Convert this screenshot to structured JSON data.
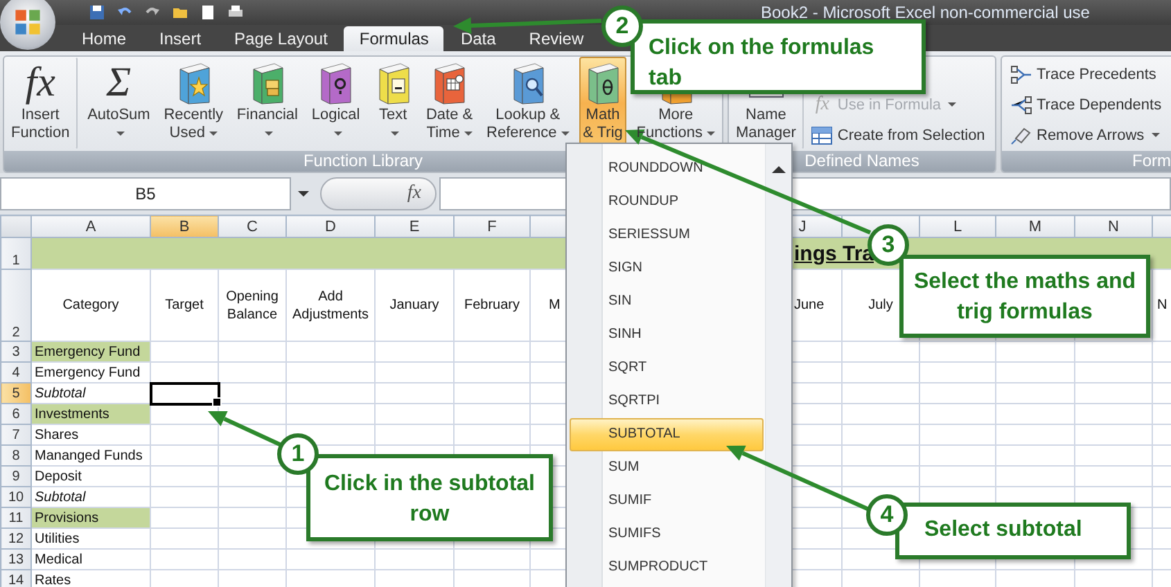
{
  "window": {
    "title": "Book2 - Microsoft Excel non-commercial use"
  },
  "tabs": [
    {
      "label": "Home",
      "selected": false
    },
    {
      "label": "Insert",
      "selected": false
    },
    {
      "label": "Page Layout",
      "selected": false
    },
    {
      "label": "Formulas",
      "selected": true
    },
    {
      "label": "Data",
      "selected": false
    },
    {
      "label": "Review",
      "selected": false
    }
  ],
  "ribbon": {
    "groups": [
      {
        "label": "Function Library",
        "items": [
          {
            "kind": "large",
            "lines": [
              "Insert",
              "Function"
            ],
            "icon": {
              "kind": "glyph",
              "glyph": "fx"
            },
            "dropdown": false,
            "pressed": false
          },
          {
            "kind": "large",
            "lines": [
              "AutoSum"
            ],
            "icon": {
              "kind": "glyph",
              "glyph": "Σ"
            },
            "dropdown": true,
            "pressed": false
          },
          {
            "kind": "large",
            "lines": [
              "Recently",
              "Used"
            ],
            "icon": {
              "kind": "star",
              "color": "#4fa3d9"
            },
            "dropdown": true,
            "pressed": false
          },
          {
            "kind": "large",
            "lines": [
              "Financial"
            ],
            "icon": {
              "kind": "coins",
              "color": "#4caf6a"
            },
            "dropdown": true,
            "pressed": false
          },
          {
            "kind": "large",
            "lines": [
              "Logical"
            ],
            "icon": {
              "kind": "question",
              "color": "#b46ac8"
            },
            "dropdown": true,
            "pressed": false
          },
          {
            "kind": "large",
            "lines": [
              "Text"
            ],
            "icon": {
              "kind": "letter",
              "color": "#eedd4a"
            },
            "dropdown": true,
            "pressed": false
          },
          {
            "kind": "large",
            "lines": [
              "Date &",
              "Time"
            ],
            "icon": {
              "kind": "calendar",
              "color": "#e8643c"
            },
            "dropdown": true,
            "pressed": false
          },
          {
            "kind": "large",
            "lines": [
              "Lookup &",
              "Reference"
            ],
            "icon": {
              "kind": "magnifier",
              "color": "#5a9ad6"
            },
            "dropdown": true,
            "pressed": false
          },
          {
            "kind": "large",
            "lines": [
              "Math",
              "& Trig"
            ],
            "icon": {
              "kind": "theta",
              "color": "#7bbf8a"
            },
            "dropdown": false,
            "pressed": true
          },
          {
            "kind": "large",
            "lines": [
              "More",
              "Functions"
            ],
            "icon": {
              "kind": "stack"
            },
            "dropdown": true,
            "pressed": false
          }
        ]
      },
      {
        "label": "Defined Names",
        "items": [
          {
            "kind": "large",
            "lines": [
              "Name",
              "Manager"
            ],
            "icon": {
              "kind": "card"
            },
            "dropdown": false,
            "pressed": false
          },
          {
            "kind": "stack",
            "buttons": [
              {
                "label": "Use in Formula",
                "icon": {
                  "kind": "glyph",
                  "glyph": "fx"
                },
                "disabled": true,
                "dropdown": true
              },
              {
                "label": "Create from Selection",
                "icon": {
                  "kind": "table"
                },
                "disabled": false,
                "dropdown": false
              }
            ]
          }
        ]
      },
      {
        "label": "Form",
        "items": [
          {
            "kind": "stack",
            "buttons": [
              {
                "label": "Trace Precedents",
                "icon": {
                  "kind": "precedents"
                },
                "disabled": false,
                "dropdown": false
              },
              {
                "label": "Trace Dependents",
                "icon": {
                  "kind": "dependents"
                },
                "disabled": false,
                "dropdown": false
              },
              {
                "label": "Remove Arrows",
                "icon": {
                  "kind": "eraser"
                },
                "disabled": false,
                "dropdown": true
              }
            ]
          }
        ]
      }
    ]
  },
  "sheet": {
    "name_box": "B5",
    "formula_glyph": "fx",
    "columns": [
      {
        "label": "A",
        "selected": false
      },
      {
        "label": "B",
        "selected": true
      },
      {
        "label": "C",
        "selected": false
      },
      {
        "label": "D",
        "selected": false
      },
      {
        "label": "E",
        "selected": false
      },
      {
        "label": "F",
        "selected": false
      },
      {},
      {},
      {},
      {
        "label": "J",
        "selected": false
      },
      {},
      {
        "label": "L",
        "selected": false
      },
      {
        "label": "M",
        "selected": false
      },
      {
        "label": "N",
        "selected": false
      },
      {}
    ],
    "rows": [
      {
        "number": "1",
        "kind": "title",
        "selected": false,
        "title": "ings Tra"
      },
      {
        "number": "2",
        "kind": "header",
        "selected": false,
        "cells": [
          "Category",
          "Target",
          "Opening Balance",
          "Add Adjustments",
          "January",
          "February",
          "M",
          null,
          null,
          "June",
          "July",
          null,
          null,
          null,
          "N"
        ]
      },
      {
        "number": "3",
        "kind": "section",
        "selected": false,
        "cells": [
          "Emergency Fund"
        ]
      },
      {
        "number": "4",
        "kind": "item",
        "selected": false,
        "cells": [
          "Emergency Fund"
        ]
      },
      {
        "number": "5",
        "kind": "subtotal",
        "selected": true,
        "cells": [
          "Subtotal"
        ]
      },
      {
        "number": "6",
        "kind": "section",
        "selected": false,
        "cells": [
          "Investments"
        ]
      },
      {
        "number": "7",
        "kind": "item",
        "selected": false,
        "cells": [
          "Shares"
        ]
      },
      {
        "number": "8",
        "kind": "item",
        "selected": false,
        "cells": [
          "Mananged Funds"
        ]
      },
      {
        "number": "9",
        "kind": "item",
        "selected": false,
        "cells": [
          "Deposit"
        ]
      },
      {
        "number": "10",
        "kind": "subtotal",
        "selected": false,
        "cells": [
          "Subtotal"
        ]
      },
      {
        "number": "11",
        "kind": "section",
        "selected": false,
        "cells": [
          "Provisions"
        ]
      },
      {
        "number": "12",
        "kind": "item",
        "selected": false,
        "cells": [
          "Utilities"
        ]
      },
      {
        "number": "13",
        "kind": "item",
        "selected": false,
        "cells": [
          "Medical"
        ]
      },
      {
        "number": "14",
        "kind": "item",
        "selected": false,
        "cells": [
          "Rates"
        ]
      }
    ]
  },
  "menu": {
    "items": [
      {
        "label": "ROUNDDOWN",
        "selected": false
      },
      {
        "label": "ROUNDUP",
        "selected": false
      },
      {
        "label": "SERIESSUM",
        "selected": false
      },
      {
        "label": "SIGN",
        "selected": false
      },
      {
        "label": "SIN",
        "selected": false
      },
      {
        "label": "SINH",
        "selected": false
      },
      {
        "label": "SQRT",
        "selected": false
      },
      {
        "label": "SQRTPI",
        "selected": false
      },
      {
        "label": "SUBTOTAL",
        "selected": true
      },
      {
        "label": "SUM",
        "selected": false
      },
      {
        "label": "SUMIF",
        "selected": false
      },
      {
        "label": "SUMIFS",
        "selected": false
      },
      {
        "label": "SUMPRODUCT",
        "selected": false
      }
    ]
  },
  "callouts": [
    {
      "number": "1",
      "text": "Click in the subtotal row"
    },
    {
      "number": "2",
      "text": "Click on the formulas tab"
    },
    {
      "number": "3",
      "text": "Select the maths and trig formulas"
    },
    {
      "number": "4",
      "text": "Select subtotal"
    }
  ]
}
